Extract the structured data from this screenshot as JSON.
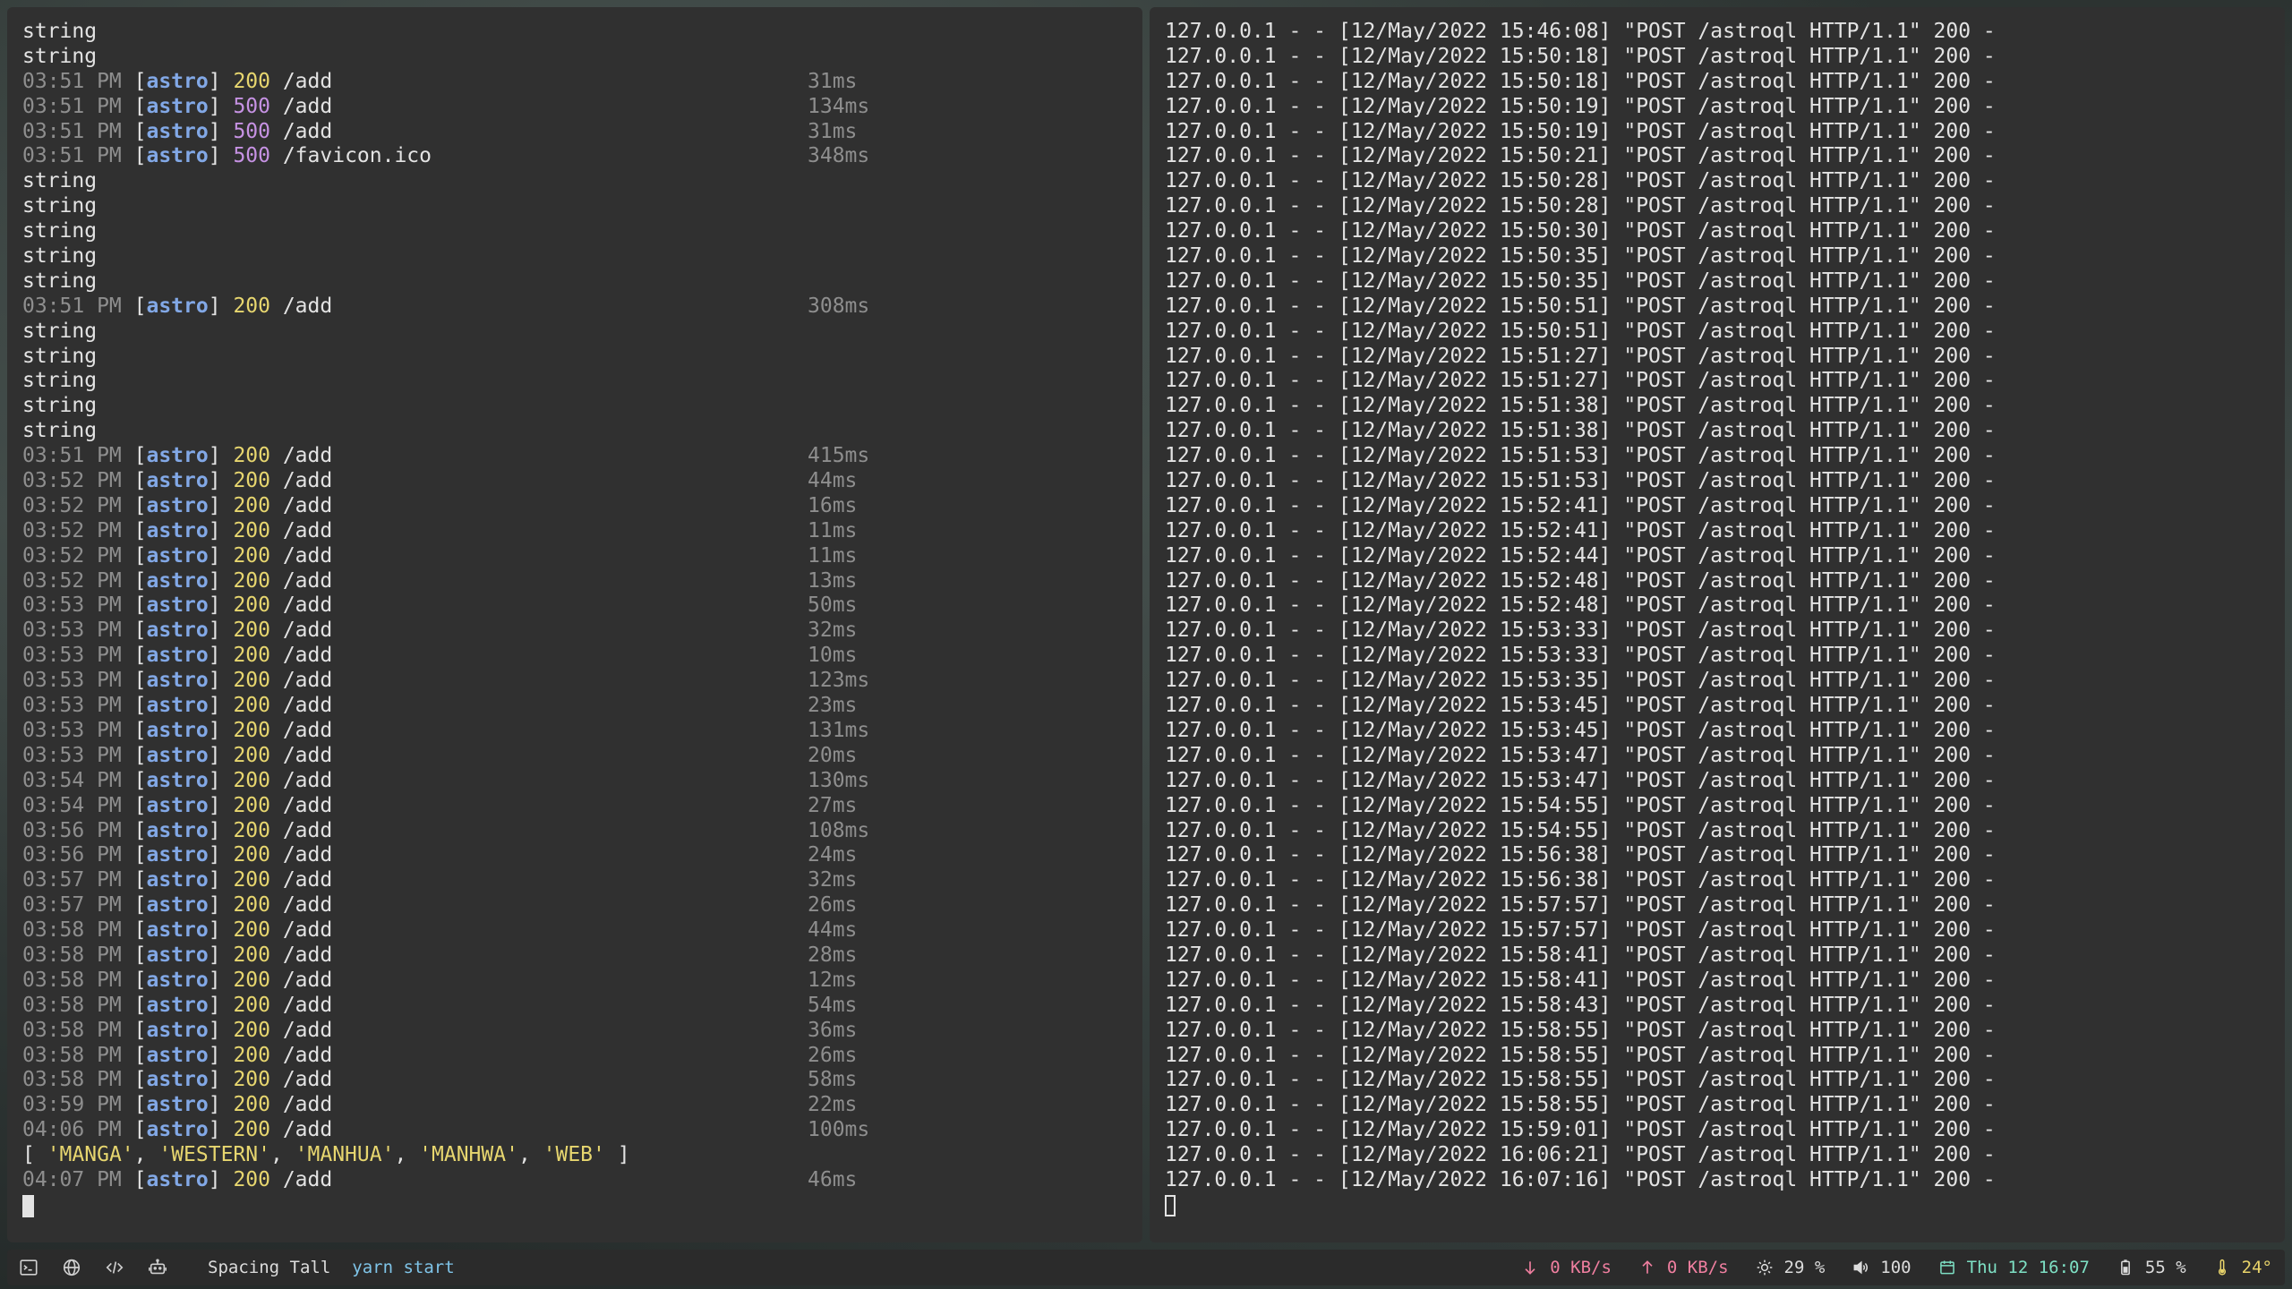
{
  "left_pane": {
    "lines": [
      {
        "kind": "text",
        "text": "string"
      },
      {
        "kind": "text",
        "text": "string"
      },
      {
        "kind": "log",
        "time": "03:51 PM",
        "tag": "astro",
        "status": "200",
        "path": "/add",
        "duration": "31ms"
      },
      {
        "kind": "log",
        "time": "03:51 PM",
        "tag": "astro",
        "status": "500",
        "path": "/add",
        "duration": "134ms"
      },
      {
        "kind": "log",
        "time": "03:51 PM",
        "tag": "astro",
        "status": "500",
        "path": "/add",
        "duration": "31ms"
      },
      {
        "kind": "log",
        "time": "03:51 PM",
        "tag": "astro",
        "status": "500",
        "path": "/favicon.ico",
        "duration": "348ms"
      },
      {
        "kind": "text",
        "text": "string"
      },
      {
        "kind": "text",
        "text": "string"
      },
      {
        "kind": "text",
        "text": "string"
      },
      {
        "kind": "text",
        "text": "string"
      },
      {
        "kind": "text",
        "text": "string"
      },
      {
        "kind": "log",
        "time": "03:51 PM",
        "tag": "astro",
        "status": "200",
        "path": "/add",
        "duration": "308ms"
      },
      {
        "kind": "text",
        "text": "string"
      },
      {
        "kind": "text",
        "text": "string"
      },
      {
        "kind": "text",
        "text": "string"
      },
      {
        "kind": "text",
        "text": "string"
      },
      {
        "kind": "text",
        "text": "string"
      },
      {
        "kind": "log",
        "time": "03:51 PM",
        "tag": "astro",
        "status": "200",
        "path": "/add",
        "duration": "415ms"
      },
      {
        "kind": "log",
        "time": "03:52 PM",
        "tag": "astro",
        "status": "200",
        "path": "/add",
        "duration": "44ms"
      },
      {
        "kind": "log",
        "time": "03:52 PM",
        "tag": "astro",
        "status": "200",
        "path": "/add",
        "duration": "16ms"
      },
      {
        "kind": "log",
        "time": "03:52 PM",
        "tag": "astro",
        "status": "200",
        "path": "/add",
        "duration": "11ms"
      },
      {
        "kind": "log",
        "time": "03:52 PM",
        "tag": "astro",
        "status": "200",
        "path": "/add",
        "duration": "11ms"
      },
      {
        "kind": "log",
        "time": "03:52 PM",
        "tag": "astro",
        "status": "200",
        "path": "/add",
        "duration": "13ms"
      },
      {
        "kind": "log",
        "time": "03:53 PM",
        "tag": "astro",
        "status": "200",
        "path": "/add",
        "duration": "50ms"
      },
      {
        "kind": "log",
        "time": "03:53 PM",
        "tag": "astro",
        "status": "200",
        "path": "/add",
        "duration": "32ms"
      },
      {
        "kind": "log",
        "time": "03:53 PM",
        "tag": "astro",
        "status": "200",
        "path": "/add",
        "duration": "10ms"
      },
      {
        "kind": "log",
        "time": "03:53 PM",
        "tag": "astro",
        "status": "200",
        "path": "/add",
        "duration": "123ms"
      },
      {
        "kind": "log",
        "time": "03:53 PM",
        "tag": "astro",
        "status": "200",
        "path": "/add",
        "duration": "23ms"
      },
      {
        "kind": "log",
        "time": "03:53 PM",
        "tag": "astro",
        "status": "200",
        "path": "/add",
        "duration": "131ms"
      },
      {
        "kind": "log",
        "time": "03:53 PM",
        "tag": "astro",
        "status": "200",
        "path": "/add",
        "duration": "20ms"
      },
      {
        "kind": "log",
        "time": "03:54 PM",
        "tag": "astro",
        "status": "200",
        "path": "/add",
        "duration": "130ms"
      },
      {
        "kind": "log",
        "time": "03:54 PM",
        "tag": "astro",
        "status": "200",
        "path": "/add",
        "duration": "27ms"
      },
      {
        "kind": "log",
        "time": "03:56 PM",
        "tag": "astro",
        "status": "200",
        "path": "/add",
        "duration": "108ms"
      },
      {
        "kind": "log",
        "time": "03:56 PM",
        "tag": "astro",
        "status": "200",
        "path": "/add",
        "duration": "24ms"
      },
      {
        "kind": "log",
        "time": "03:57 PM",
        "tag": "astro",
        "status": "200",
        "path": "/add",
        "duration": "32ms"
      },
      {
        "kind": "log",
        "time": "03:57 PM",
        "tag": "astro",
        "status": "200",
        "path": "/add",
        "duration": "26ms"
      },
      {
        "kind": "log",
        "time": "03:58 PM",
        "tag": "astro",
        "status": "200",
        "path": "/add",
        "duration": "44ms"
      },
      {
        "kind": "log",
        "time": "03:58 PM",
        "tag": "astro",
        "status": "200",
        "path": "/add",
        "duration": "28ms"
      },
      {
        "kind": "log",
        "time": "03:58 PM",
        "tag": "astro",
        "status": "200",
        "path": "/add",
        "duration": "12ms"
      },
      {
        "kind": "log",
        "time": "03:58 PM",
        "tag": "astro",
        "status": "200",
        "path": "/add",
        "duration": "54ms"
      },
      {
        "kind": "log",
        "time": "03:58 PM",
        "tag": "astro",
        "status": "200",
        "path": "/add",
        "duration": "36ms"
      },
      {
        "kind": "log",
        "time": "03:58 PM",
        "tag": "astro",
        "status": "200",
        "path": "/add",
        "duration": "26ms"
      },
      {
        "kind": "log",
        "time": "03:58 PM",
        "tag": "astro",
        "status": "200",
        "path": "/add",
        "duration": "58ms"
      },
      {
        "kind": "log",
        "time": "03:59 PM",
        "tag": "astro",
        "status": "200",
        "path": "/add",
        "duration": "22ms"
      },
      {
        "kind": "log",
        "time": "04:06 PM",
        "tag": "astro",
        "status": "200",
        "path": "/add",
        "duration": "100ms"
      },
      {
        "kind": "array",
        "items": [
          "'MANGA'",
          "'WESTERN'",
          "'MANHUA'",
          "'MANHWA'",
          "'WEB'"
        ]
      },
      {
        "kind": "log",
        "time": "04:07 PM",
        "tag": "astro",
        "status": "200",
        "path": "/add",
        "duration": "46ms"
      }
    ]
  },
  "right_pane": {
    "lines": [
      "127.0.0.1 - - [12/May/2022 15:46:08] \"POST /astroql HTTP/1.1\" 200 -",
      "127.0.0.1 - - [12/May/2022 15:50:18] \"POST /astroql HTTP/1.1\" 200 -",
      "127.0.0.1 - - [12/May/2022 15:50:18] \"POST /astroql HTTP/1.1\" 200 -",
      "127.0.0.1 - - [12/May/2022 15:50:19] \"POST /astroql HTTP/1.1\" 200 -",
      "127.0.0.1 - - [12/May/2022 15:50:19] \"POST /astroql HTTP/1.1\" 200 -",
      "127.0.0.1 - - [12/May/2022 15:50:21] \"POST /astroql HTTP/1.1\" 200 -",
      "127.0.0.1 - - [12/May/2022 15:50:28] \"POST /astroql HTTP/1.1\" 200 -",
      "127.0.0.1 - - [12/May/2022 15:50:28] \"POST /astroql HTTP/1.1\" 200 -",
      "127.0.0.1 - - [12/May/2022 15:50:30] \"POST /astroql HTTP/1.1\" 200 -",
      "127.0.0.1 - - [12/May/2022 15:50:35] \"POST /astroql HTTP/1.1\" 200 -",
      "127.0.0.1 - - [12/May/2022 15:50:35] \"POST /astroql HTTP/1.1\" 200 -",
      "127.0.0.1 - - [12/May/2022 15:50:51] \"POST /astroql HTTP/1.1\" 200 -",
      "127.0.0.1 - - [12/May/2022 15:50:51] \"POST /astroql HTTP/1.1\" 200 -",
      "127.0.0.1 - - [12/May/2022 15:51:27] \"POST /astroql HTTP/1.1\" 200 -",
      "127.0.0.1 - - [12/May/2022 15:51:27] \"POST /astroql HTTP/1.1\" 200 -",
      "127.0.0.1 - - [12/May/2022 15:51:38] \"POST /astroql HTTP/1.1\" 200 -",
      "127.0.0.1 - - [12/May/2022 15:51:38] \"POST /astroql HTTP/1.1\" 200 -",
      "127.0.0.1 - - [12/May/2022 15:51:53] \"POST /astroql HTTP/1.1\" 200 -",
      "127.0.0.1 - - [12/May/2022 15:51:53] \"POST /astroql HTTP/1.1\" 200 -",
      "127.0.0.1 - - [12/May/2022 15:52:41] \"POST /astroql HTTP/1.1\" 200 -",
      "127.0.0.1 - - [12/May/2022 15:52:41] \"POST /astroql HTTP/1.1\" 200 -",
      "127.0.0.1 - - [12/May/2022 15:52:44] \"POST /astroql HTTP/1.1\" 200 -",
      "127.0.0.1 - - [12/May/2022 15:52:48] \"POST /astroql HTTP/1.1\" 200 -",
      "127.0.0.1 - - [12/May/2022 15:52:48] \"POST /astroql HTTP/1.1\" 200 -",
      "127.0.0.1 - - [12/May/2022 15:53:33] \"POST /astroql HTTP/1.1\" 200 -",
      "127.0.0.1 - - [12/May/2022 15:53:33] \"POST /astroql HTTP/1.1\" 200 -",
      "127.0.0.1 - - [12/May/2022 15:53:35] \"POST /astroql HTTP/1.1\" 200 -",
      "127.0.0.1 - - [12/May/2022 15:53:45] \"POST /astroql HTTP/1.1\" 200 -",
      "127.0.0.1 - - [12/May/2022 15:53:45] \"POST /astroql HTTP/1.1\" 200 -",
      "127.0.0.1 - - [12/May/2022 15:53:47] \"POST /astroql HTTP/1.1\" 200 -",
      "127.0.0.1 - - [12/May/2022 15:53:47] \"POST /astroql HTTP/1.1\" 200 -",
      "127.0.0.1 - - [12/May/2022 15:54:55] \"POST /astroql HTTP/1.1\" 200 -",
      "127.0.0.1 - - [12/May/2022 15:54:55] \"POST /astroql HTTP/1.1\" 200 -",
      "127.0.0.1 - - [12/May/2022 15:56:38] \"POST /astroql HTTP/1.1\" 200 -",
      "127.0.0.1 - - [12/May/2022 15:56:38] \"POST /astroql HTTP/1.1\" 200 -",
      "127.0.0.1 - - [12/May/2022 15:57:57] \"POST /astroql HTTP/1.1\" 200 -",
      "127.0.0.1 - - [12/May/2022 15:57:57] \"POST /astroql HTTP/1.1\" 200 -",
      "127.0.0.1 - - [12/May/2022 15:58:41] \"POST /astroql HTTP/1.1\" 200 -",
      "127.0.0.1 - - [12/May/2022 15:58:41] \"POST /astroql HTTP/1.1\" 200 -",
      "127.0.0.1 - - [12/May/2022 15:58:43] \"POST /astroql HTTP/1.1\" 200 -",
      "127.0.0.1 - - [12/May/2022 15:58:55] \"POST /astroql HTTP/1.1\" 200 -",
      "127.0.0.1 - - [12/May/2022 15:58:55] \"POST /astroql HTTP/1.1\" 200 -",
      "127.0.0.1 - - [12/May/2022 15:58:55] \"POST /astroql HTTP/1.1\" 200 -",
      "127.0.0.1 - - [12/May/2022 15:58:55] \"POST /astroql HTTP/1.1\" 200 -",
      "127.0.0.1 - - [12/May/2022 15:59:01] \"POST /astroql HTTP/1.1\" 200 -",
      "127.0.0.1 - - [12/May/2022 16:06:21] \"POST /astroql HTTP/1.1\" 200 -",
      "127.0.0.1 - - [12/May/2022 16:07:16] \"POST /astroql HTTP/1.1\" 200 -"
    ]
  },
  "status_bar": {
    "icons": [
      "terminal-icon",
      "globe-icon",
      "code-icon",
      "robot-icon"
    ],
    "layout_name": "Spacing Tall",
    "window_title": "yarn start",
    "net_down": "0 KB/s",
    "net_up": "0 KB/s",
    "cpu": "29 %",
    "volume": "100",
    "datetime": "Thu 12 16:07",
    "battery": "55 %",
    "temperature": "24°"
  },
  "colors": {
    "pane_bg": "#303030",
    "text": "#e3e3e3",
    "timestamp": "#8e8e8e",
    "tag": "#82a8e6",
    "status_200": "#e7d66f",
    "status_500": "#c692e3",
    "string": "#e7d66f",
    "accent_blue": "#7fc4e8",
    "accent_pink": "#f07fa0",
    "accent_mint": "#7ee0c4",
    "accent_yellow": "#e8d36a"
  }
}
